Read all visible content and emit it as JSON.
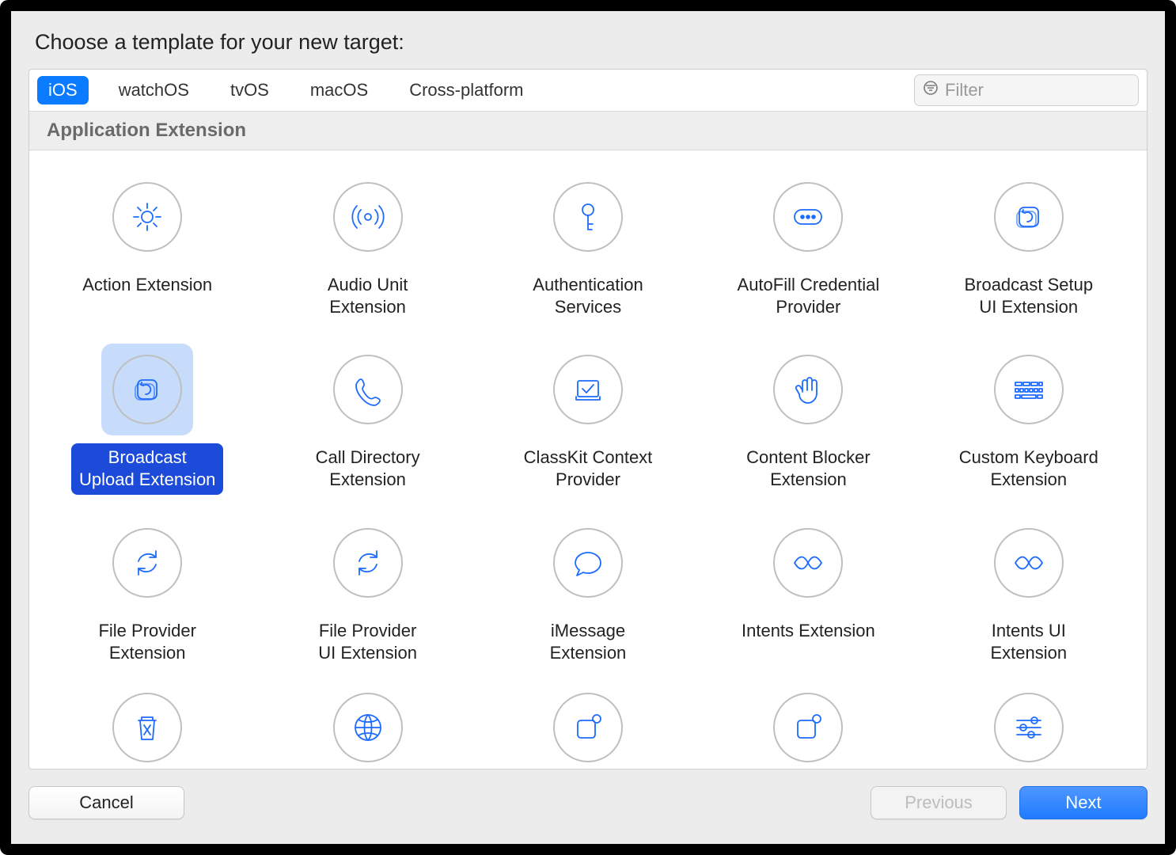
{
  "title": "Choose a template for your new target:",
  "tabs": [
    "iOS",
    "watchOS",
    "tvOS",
    "macOS",
    "Cross-platform"
  ],
  "selected_tab_index": 0,
  "filter_placeholder": "Filter",
  "section_title": "Application Extension",
  "selected_item_index": 5,
  "items": [
    {
      "icon": "gear",
      "label": "Action Extension"
    },
    {
      "icon": "radio",
      "label": "Audio Unit\nExtension"
    },
    {
      "icon": "key",
      "label": "Authentication\nServices"
    },
    {
      "icon": "dots",
      "label": "AutoFill Credential\nProvider"
    },
    {
      "icon": "stack-rot",
      "label": "Broadcast Setup\nUI Extension"
    },
    {
      "icon": "stack-rot",
      "label": "Broadcast\nUpload Extension"
    },
    {
      "icon": "phone",
      "label": "Call Directory\nExtension"
    },
    {
      "icon": "check-art",
      "label": "ClassKit Context\nProvider"
    },
    {
      "icon": "hand",
      "label": "Content Blocker\nExtension"
    },
    {
      "icon": "keyboard",
      "label": "Custom Keyboard\nExtension"
    },
    {
      "icon": "sync",
      "label": "File Provider\nExtension"
    },
    {
      "icon": "sync",
      "label": "File Provider\nUI Extension"
    },
    {
      "icon": "bubble",
      "label": "iMessage\nExtension"
    },
    {
      "icon": "wave",
      "label": "Intents Extension"
    },
    {
      "icon": "wave",
      "label": "Intents UI\nExtension"
    },
    {
      "icon": "trash",
      "label": ""
    },
    {
      "icon": "globe",
      "label": ""
    },
    {
      "icon": "square-dot",
      "label": ""
    },
    {
      "icon": "square-dot",
      "label": ""
    },
    {
      "icon": "sliders",
      "label": ""
    }
  ],
  "buttons": {
    "cancel": "Cancel",
    "previous": "Previous",
    "next": "Next"
  }
}
